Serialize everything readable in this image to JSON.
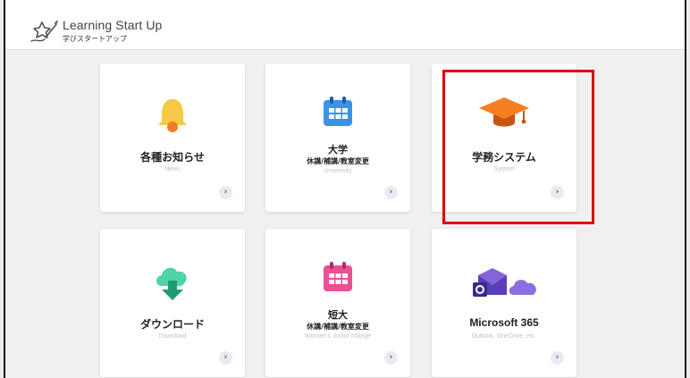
{
  "header": {
    "title": "Learning Start Up",
    "subtitle": "学びスタートアップ",
    "logo_icon": "handwriting-star-icon"
  },
  "cards": [
    {
      "id": "news",
      "title": "各種お知らせ",
      "subtitle": "",
      "en": "News",
      "icon": "bell-icon"
    },
    {
      "id": "university",
      "title": "大学",
      "subtitle": "休講/補講/教室変更",
      "en": "University",
      "icon": "calendar-icon"
    },
    {
      "id": "system",
      "title": "学務システム",
      "subtitle": "",
      "en": "System",
      "icon": "graduation-cap-icon"
    },
    {
      "id": "download",
      "title": "ダウンロード",
      "subtitle": "",
      "en": "Download",
      "icon": "cloud-download-icon"
    },
    {
      "id": "junior",
      "title": "短大",
      "subtitle": "休講/補講/教室変更",
      "en": "Women's Junior college",
      "icon": "calendar-icon"
    },
    {
      "id": "microsoft",
      "title": "Microsoft 365",
      "subtitle": "",
      "en": "Outlook, OneDrive, etc.",
      "icon": "outlook-onedrive-icon"
    }
  ],
  "arrow_glyph": "›",
  "colors": {
    "bell": "#f9c846",
    "bell_clapper": "#ef7d2c",
    "calendar_blue": "#3b93e6",
    "calendar_pink": "#ec4f93",
    "cap": "#f57e1f",
    "cloud_green": "#4ed4a6",
    "outlook_purple": "#6b4fc8",
    "onedrive_purple": "#8b6ee0",
    "highlight_red": "#e00000"
  }
}
